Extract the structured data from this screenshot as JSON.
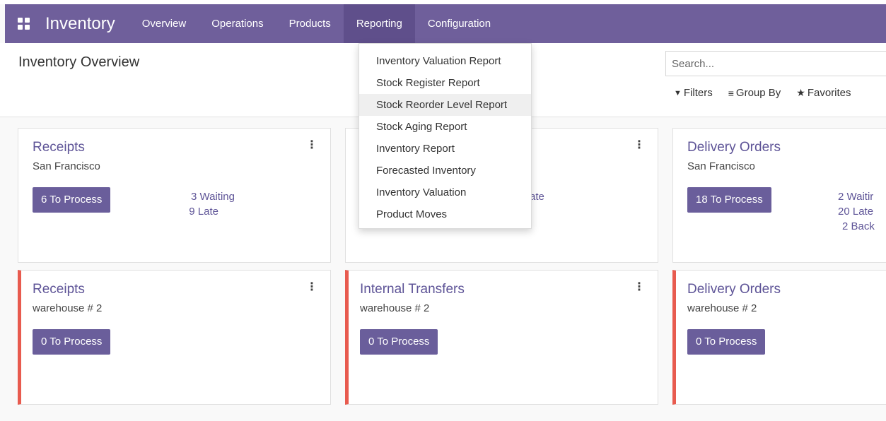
{
  "navbar": {
    "brand": "Inventory",
    "items": [
      {
        "label": "Overview"
      },
      {
        "label": "Operations"
      },
      {
        "label": "Products"
      },
      {
        "label": "Reporting"
      },
      {
        "label": "Configuration"
      }
    ],
    "active": "Reporting",
    "color": "#6f5f9b"
  },
  "control_panel": {
    "title": "Inventory Overview",
    "search_placeholder": "Search...",
    "filters_label": "Filters",
    "groupby_label": "Group By",
    "favorites_label": "Favorites"
  },
  "reporting_menu": {
    "items": [
      {
        "label": "Inventory Valuation Report"
      },
      {
        "label": "Stock Register Report"
      },
      {
        "label": "Stock Reorder Level Report"
      },
      {
        "label": "Stock Aging Report"
      },
      {
        "label": "Inventory Report"
      },
      {
        "label": "Forecasted Inventory"
      },
      {
        "label": "Inventory Valuation"
      },
      {
        "label": "Product Moves"
      }
    ],
    "highlighted": "Stock Reorder Level Report"
  },
  "cards": [
    {
      "title": "Receipts",
      "subtitle": "San Francisco",
      "button": "6 To Process",
      "stats": [
        "3 Waiting",
        "9 Late"
      ]
    },
    {
      "title": "",
      "subtitle": "",
      "button": "",
      "stats": [
        "ate"
      ]
    },
    {
      "title": "Delivery Orders",
      "subtitle": "San Francisco",
      "button": "18 To Process",
      "stats": [
        "2 Waitir",
        "20 Late",
        "2 Back"
      ]
    },
    {
      "title": "Receipts",
      "subtitle": "warehouse # 2",
      "button": "0 To Process",
      "stats": []
    },
    {
      "title": "Internal Transfers",
      "subtitle": "warehouse # 2",
      "button": "0 To Process",
      "stats": []
    },
    {
      "title": "Delivery Orders",
      "subtitle": "warehouse # 2",
      "button": "0 To Process",
      "stats": []
    }
  ],
  "colors": {
    "accent": "#6a5e9b",
    "alert_border": "#e85b4f",
    "link": "#5e5497"
  }
}
